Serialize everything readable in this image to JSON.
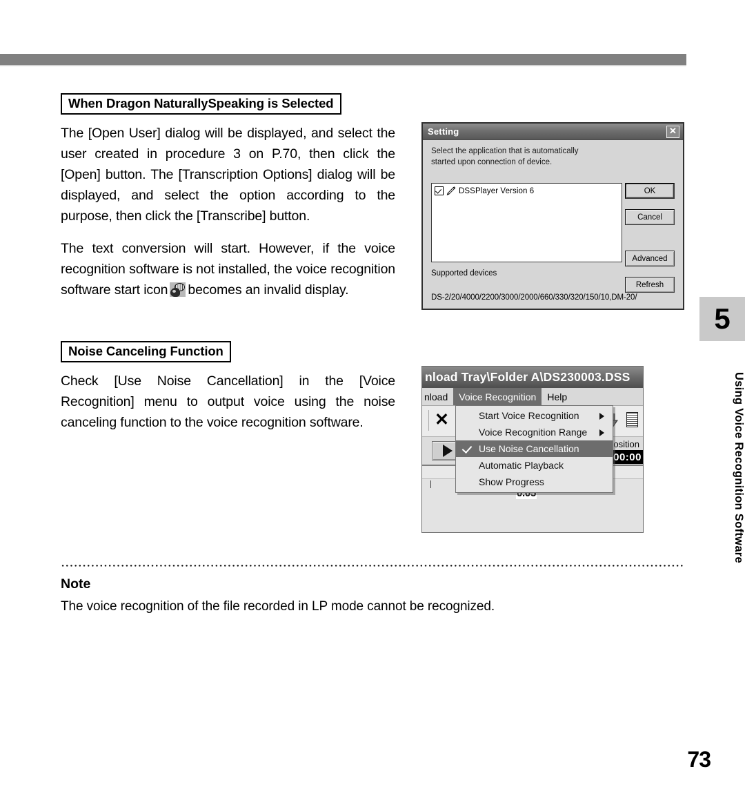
{
  "page": {
    "number": "73"
  },
  "chapter_tab": {
    "number": "5",
    "title": "Using Voice Recognition Software"
  },
  "sections": [
    {
      "heading": "When Dragon NaturallySpeaking is Selected",
      "paragraph1": "The [Open User] dialog will be displayed, and select the user created in procedure 3 on P.70, then click the [Open] button.  The [Transcription Options] dialog will be displayed, and select the option according to the purpose, then click the [Transcribe] button.",
      "paragraph2_before_icon": "The text conversion will start.  However, if the voice recognition software is not installed, the voice recognition software start icon",
      "paragraph2_after_icon": "becomes an invalid display.",
      "inline_icon_name": "voice-recognition-start-icon"
    },
    {
      "heading": "Noise Canceling Function",
      "paragraph1": "Check [Use Noise Cancellation] in the [Voice Recognition] menu to output voice using the noise canceling function to the voice recognition software."
    }
  ],
  "note": {
    "heading": "Note",
    "text": "The voice recognition of the file recorded in LP mode cannot be recognized."
  },
  "setting_dialog": {
    "title": "Setting",
    "close_label": "✕",
    "description": "Select the application that is automatically started upon connection of device.",
    "app_list": [
      {
        "label": "DSSPlayer Version 6",
        "checked": true
      }
    ],
    "supported_devices_label": "Supported devices",
    "supported_devices_value": "DS-2/20/4000/2200/3000/2000/660/330/320/150/10,DM-20/",
    "buttons": {
      "ok": "OK",
      "cancel": "Cancel",
      "advanced": "Advanced",
      "refresh": "Refresh"
    }
  },
  "dss_player": {
    "title": "nload Tray\\Folder A\\DS230003.DSS",
    "menubar": [
      {
        "label": "nload",
        "selected": false
      },
      {
        "label": "Voice Recognition",
        "selected": true
      },
      {
        "label": "Help",
        "selected": false
      }
    ],
    "voice_recognition_menu": [
      {
        "label": "Start Voice Recognition",
        "submenu": true,
        "checked": false,
        "selected": false
      },
      {
        "label": "Voice Recognition Range",
        "submenu": true,
        "checked": false,
        "selected": false
      },
      {
        "label": "Use Noise Cancellation",
        "submenu": false,
        "checked": true,
        "selected": true
      },
      {
        "label": "Automatic Playback",
        "submenu": false,
        "checked": false,
        "selected": false
      },
      {
        "label": "Show Progress",
        "submenu": false,
        "checked": false,
        "selected": false
      }
    ],
    "position_label": "osition",
    "position_time": "00:00",
    "ruler_label": "0.05"
  },
  "colors": {
    "header_rule": "#808080",
    "chapter_tab_bg": "#c9c9c9",
    "menu_highlight": "#6d6d6d",
    "dialog_face": "#d6d6d6"
  }
}
